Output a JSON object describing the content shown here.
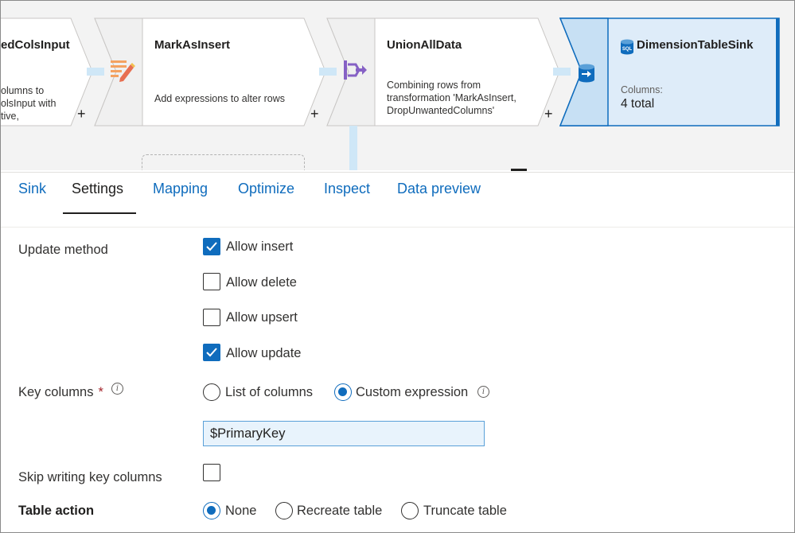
{
  "pipeline": {
    "nodes": [
      {
        "title": "edColsInput",
        "desc": [
          "olumns to",
          "olsInput with",
          "tive,"
        ],
        "plus": "+"
      },
      {
        "title": "MarkAsInsert",
        "desc": [
          "Add expressions to alter rows"
        ],
        "plus": "+",
        "icon": "alter-row-icon"
      },
      {
        "title": "UnionAllData",
        "desc": [
          "Combining rows from",
          "transformation 'MarkAsInsert,",
          "DropUnwantedColumns'"
        ],
        "plus": "+",
        "icon": "union-icon"
      },
      {
        "title": "DimensionTableSink",
        "badge": "SQL",
        "columns_label": "Columns:",
        "columns_value": "4 total",
        "icon": "sink-icon",
        "selected": true
      }
    ]
  },
  "tabs": [
    {
      "label": "Sink",
      "active": false
    },
    {
      "label": "Settings",
      "active": true
    },
    {
      "label": "Mapping",
      "active": false
    },
    {
      "label": "Optimize",
      "active": false
    },
    {
      "label": "Inspect",
      "active": false
    },
    {
      "label": "Data preview",
      "active": false
    }
  ],
  "settings": {
    "update_method": {
      "label": "Update method",
      "options": [
        {
          "label": "Allow insert",
          "checked": true
        },
        {
          "label": "Allow delete",
          "checked": false
        },
        {
          "label": "Allow upsert",
          "checked": false
        },
        {
          "label": "Allow update",
          "checked": true
        }
      ]
    },
    "key_columns": {
      "label": "Key columns",
      "required_mark": "*",
      "options": [
        {
          "label": "List of columns",
          "selected": false
        },
        {
          "label": "Custom expression",
          "selected": true
        }
      ],
      "expression_value": "$PrimaryKey"
    },
    "skip_writing": {
      "label": "Skip writing key columns",
      "checked": false
    },
    "table_action": {
      "label": "Table action",
      "options": [
        {
          "label": "None",
          "selected": true
        },
        {
          "label": "Recreate table",
          "selected": false
        },
        {
          "label": "Truncate table",
          "selected": false
        }
      ]
    }
  },
  "colors": {
    "accent": "#0f6cbd",
    "selected_node": "#deecf9",
    "canvas_bg": "#f3f3f3"
  }
}
